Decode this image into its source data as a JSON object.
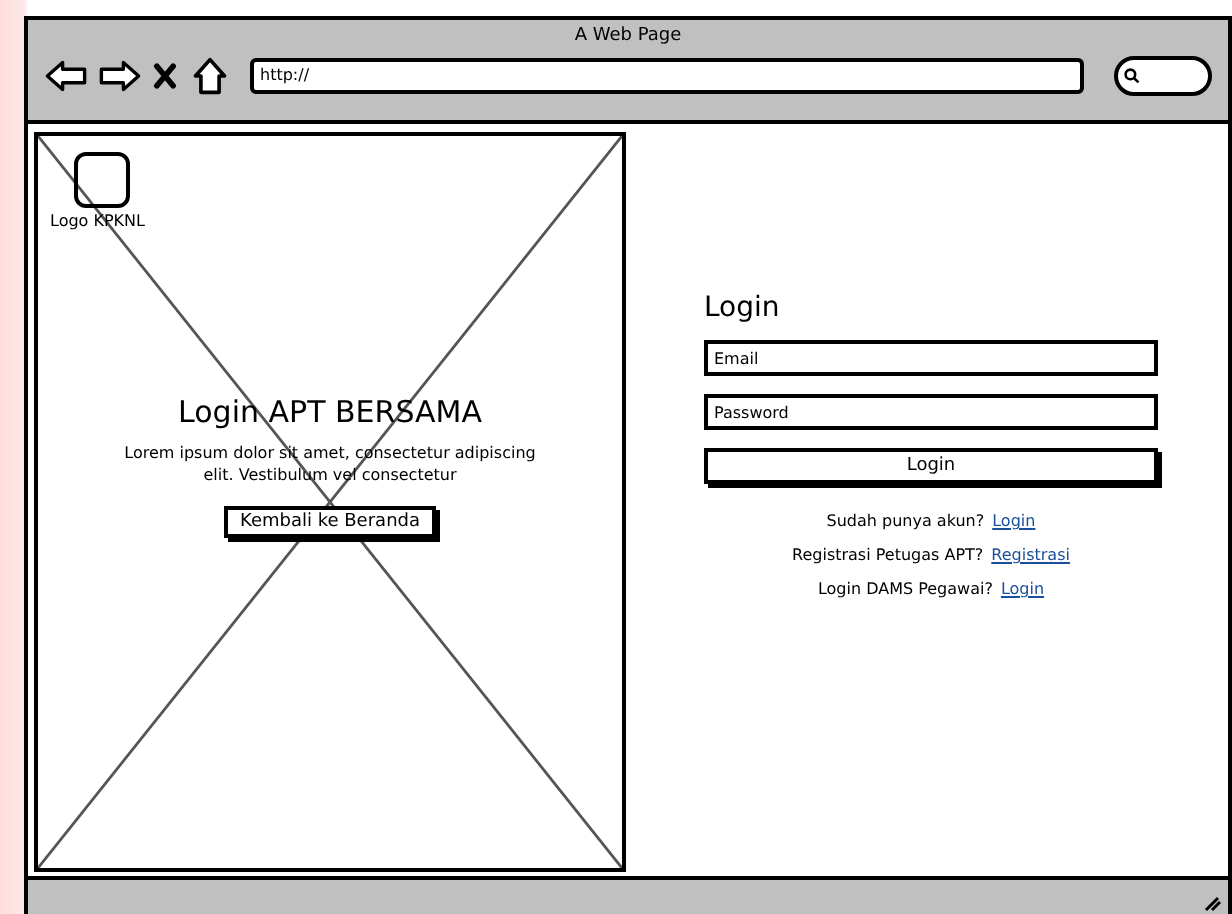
{
  "window": {
    "title": "A Web Page",
    "url": "http://"
  },
  "hero": {
    "logo_label": "Logo KPKNL",
    "title": "Login APT BERSAMA",
    "text": "Lorem ipsum dolor sit amet, consectetur adipiscing elit. Vestibulum vel consectetur",
    "button": "Kembali ke Beranda"
  },
  "login": {
    "title": "Login",
    "fields": [
      {
        "placeholder": "Email"
      },
      {
        "placeholder": "Password"
      }
    ],
    "button": "Login",
    "links": [
      {
        "text": "Sudah punya akun?",
        "link": "Login"
      },
      {
        "text": "Registrasi Petugas APT?",
        "link": "Registrasi"
      },
      {
        "text": "Login DAMS Pegawai?",
        "link": "Login"
      }
    ]
  }
}
